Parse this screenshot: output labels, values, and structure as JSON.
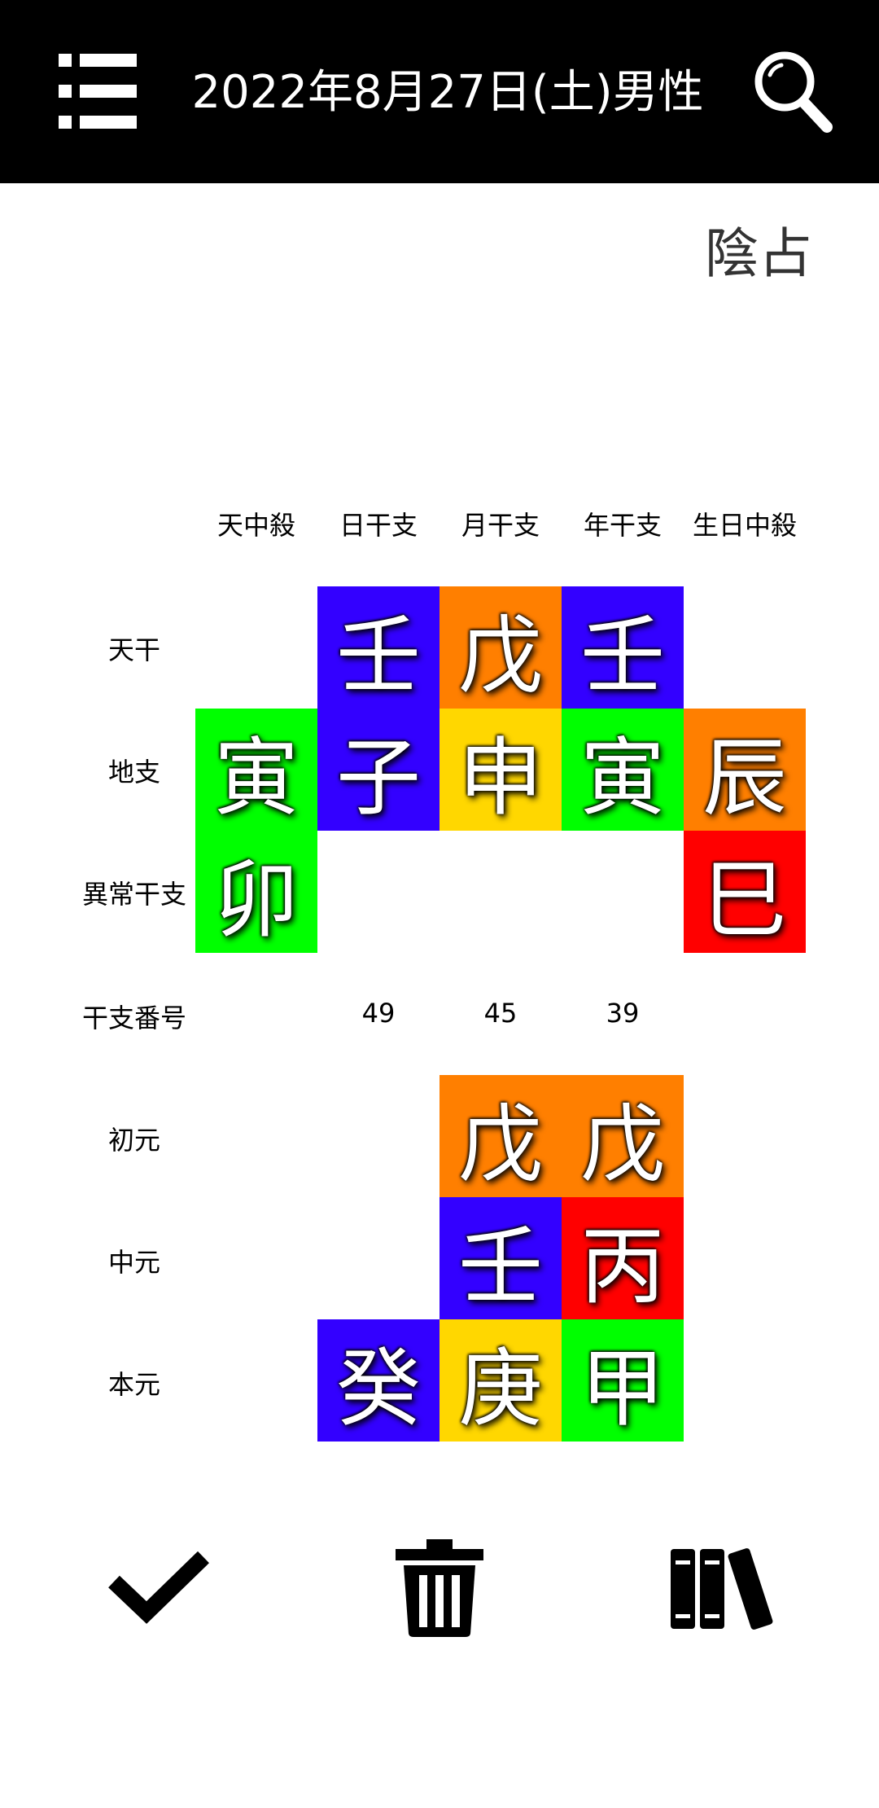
{
  "header": {
    "title": "2022年8月27日(土)男性",
    "menu_icon": "list-icon",
    "search_icon": "search-icon"
  },
  "mode_label": "陰占",
  "table": {
    "columns": [
      "天中殺",
      "日干支",
      "月干支",
      "年干支",
      "生日中殺"
    ],
    "rows": [
      "天干",
      "地支",
      "異常干支",
      "干支番号",
      "初元",
      "中元",
      "本元"
    ],
    "tenkan": {
      "day": "壬",
      "month": "戊",
      "year": "壬"
    },
    "chishi": {
      "tenchusatsu": "寅",
      "day": "子",
      "month": "申",
      "year": "寅",
      "seijitsu": "辰"
    },
    "ijou": {
      "tenchusatsu": "卯",
      "seijitsu": "巳"
    },
    "numbers": {
      "day": "49",
      "month": "45",
      "year": "39"
    },
    "shogen": {
      "month": "戊",
      "year": "戊"
    },
    "chugen": {
      "month": "壬",
      "year": "丙"
    },
    "hongen": {
      "day": "癸",
      "month": "庚",
      "year": "甲"
    }
  },
  "colors": {
    "blue": "#3300ff",
    "orange": "#ff7f00",
    "yellow": "#ffd700",
    "green": "#00ff00",
    "red": "#ff0000"
  },
  "bottom_bar": {
    "icons": [
      "check-icon",
      "trash-icon",
      "books-icon"
    ]
  }
}
